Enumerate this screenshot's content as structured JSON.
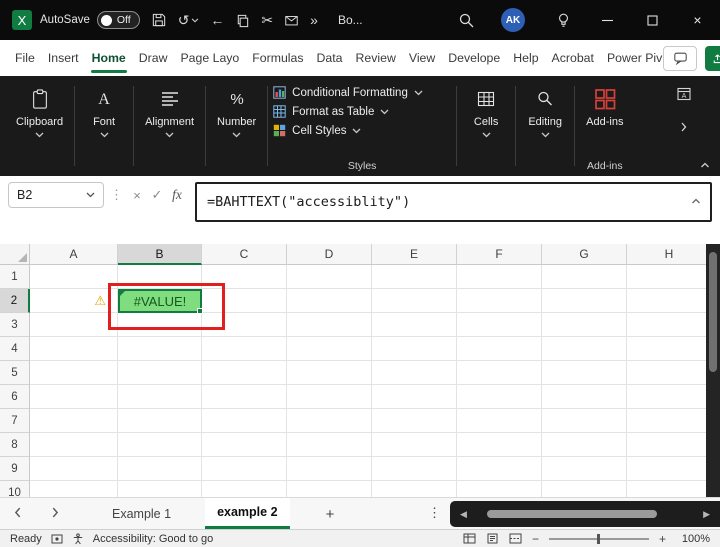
{
  "titlebar": {
    "autosave_label": "AutoSave",
    "autosave_state": "Off",
    "workbook_name": "Bo...",
    "avatar": "AK"
  },
  "menubar": {
    "active_tab": "Home",
    "tabs": [
      {
        "label": "File"
      },
      {
        "label": "Insert"
      },
      {
        "label": "Home"
      },
      {
        "label": "Draw"
      },
      {
        "label": "Page Layo"
      },
      {
        "label": "Formulas"
      },
      {
        "label": "Data"
      },
      {
        "label": "Review"
      },
      {
        "label": "View"
      },
      {
        "label": "Develope"
      },
      {
        "label": "Help"
      },
      {
        "label": "Acrobat"
      },
      {
        "label": "Power Piv"
      }
    ]
  },
  "ribbon": {
    "groups_left": [
      {
        "label": "Clipboard",
        "icon": "clipboard-icon"
      },
      {
        "label": "Font",
        "icon": "font-icon"
      },
      {
        "label": "Alignment",
        "icon": "alignment-icon"
      },
      {
        "label": "Number",
        "icon": "number-icon"
      }
    ],
    "styles": {
      "group_label": "Styles",
      "items": [
        {
          "label": "Conditional Formatting",
          "icon": "conditional-formatting-icon"
        },
        {
          "label": "Format as Table",
          "icon": "format-as-table-icon"
        },
        {
          "label": "Cell Styles",
          "icon": "cell-styles-icon"
        }
      ]
    },
    "groups_right": [
      {
        "label": "Cells",
        "icon": "cells-icon"
      },
      {
        "label": "Editing",
        "icon": "editing-icon"
      },
      {
        "label": "Add-ins",
        "icon": "add-ins-icon",
        "group_label": "Add-ins",
        "has_menu": false
      }
    ]
  },
  "formula_bar": {
    "name_box": "B2",
    "fx_label": "fx",
    "formula": "=BAHTTEXT(\"accessiblity\")"
  },
  "grid": {
    "column_headers": [
      "A",
      "B",
      "C",
      "D",
      "E",
      "F",
      "G",
      "H"
    ],
    "row_headers": [
      "1",
      "2",
      "3",
      "4",
      "5",
      "6",
      "7",
      "8",
      "9",
      "10"
    ],
    "selected_column": "B",
    "selected_row": "2",
    "active_cell_ref": "B2",
    "active_cell_value": "#VALUE!"
  },
  "sheet_tabs": {
    "active": "example 2",
    "add_label": "+",
    "tabs": [
      {
        "label": "Example 1"
      },
      {
        "label": "example 2"
      }
    ]
  },
  "status_bar": {
    "ready_label": "Ready",
    "accessibility_label": "Accessibility: Good to go",
    "zoom_level": "100%"
  },
  "icons": {
    "undo": "↺",
    "redo_back": "←",
    "overflow": "»",
    "more_dots": "⋮",
    "cancel": "×",
    "check": "✓",
    "warning": "⚠",
    "scissors": "✂",
    "scroll_left": "◀",
    "scroll_right": "▶",
    "zoom_minus": "−",
    "zoom_plus": "+",
    "close": "×"
  },
  "colors": {
    "accent_green": "#107C41",
    "titlebar_bg": "#0B0B0B",
    "ribbon_bg": "#1A1A1A",
    "cell_fill_green": "#7FDC7F",
    "cell_text_green": "#14591D",
    "annotation_red": "#E01F1F",
    "warning_yellow": "#E8A700",
    "avatar_blue": "#2E5FB7",
    "share_green": "#107C41",
    "addin_red": "#D9403A"
  }
}
